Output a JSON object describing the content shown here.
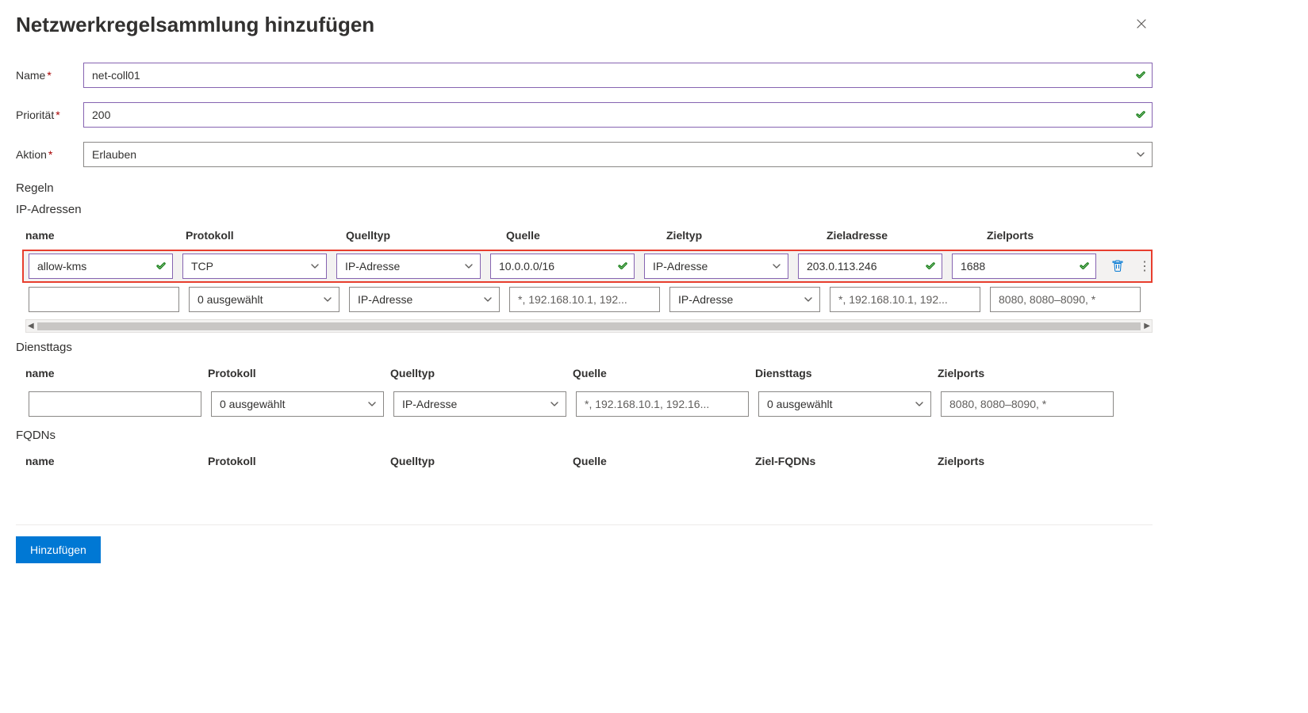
{
  "header": {
    "title": "Netzwerkregelsammlung hinzufügen"
  },
  "form": {
    "name_label": "Name",
    "name_value": "net-coll01",
    "priority_label": "Priorität",
    "priority_value": "200",
    "action_label": "Aktion",
    "action_value": "Erlauben"
  },
  "rules": {
    "section_label": "Regeln",
    "ip": {
      "label": "IP-Adressen",
      "headers": {
        "name": "name",
        "protocol": "Protokoll",
        "source_type": "Quelltyp",
        "source": "Quelle",
        "dest_type": "Zieltyp",
        "dest_addr": "Zieladresse",
        "dest_ports": "Zielports"
      },
      "rows": [
        {
          "name": "allow-kms",
          "protocol": "TCP",
          "source_type": "IP-Adresse",
          "source": "10.0.0.0/16",
          "dest_type": "IP-Adresse",
          "dest_addr": "203.0.113.246",
          "dest_ports": "1688"
        }
      ],
      "blank": {
        "protocol": "0 ausgewählt",
        "source_type": "IP-Adresse",
        "source_ph": "*, 192.168.10.1, 192...",
        "dest_type": "IP-Adresse",
        "dest_addr_ph": "*, 192.168.10.1, 192...",
        "dest_ports_ph": "8080, 8080–8090, *"
      }
    },
    "st": {
      "label": "Diensttags",
      "headers": {
        "name": "name",
        "protocol": "Protokoll",
        "source_type": "Quelltyp",
        "source": "Quelle",
        "service_tags": "Diensttags",
        "dest_ports": "Zielports"
      },
      "blank": {
        "protocol": "0 ausgewählt",
        "source_type": "IP-Adresse",
        "source_ph": "*, 192.168.10.1, 192.16...",
        "service_tags": "0 ausgewählt",
        "dest_ports_ph": "8080, 8080–8090, *"
      }
    },
    "fq": {
      "label": "FQDNs",
      "headers": {
        "name": "name",
        "protocol": "Protokoll",
        "source_type": "Quelltyp",
        "source": "Quelle",
        "dest_fqdns": "Ziel-FQDNs",
        "dest_ports": "Zielports"
      }
    }
  },
  "footer": {
    "add_label": "Hinzufügen"
  }
}
